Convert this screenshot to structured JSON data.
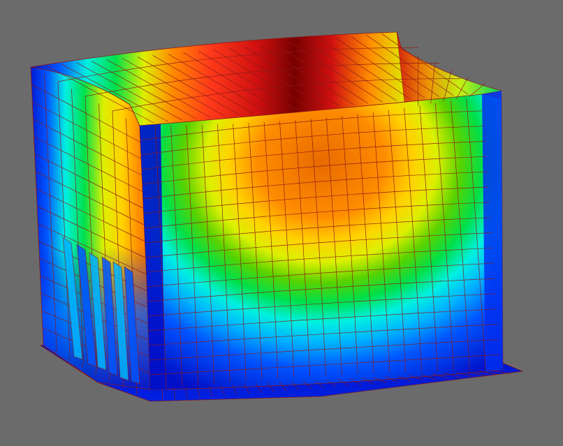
{
  "viewport": {
    "background": "#6b6b6b",
    "mesh_line_color": "#8b1a1a",
    "colormap": [
      "#0010c8",
      "#0055ff",
      "#00b4ff",
      "#00f0e0",
      "#00e04a",
      "#5ad200",
      "#dcf000",
      "#ffd200",
      "#ff8c00",
      "#e86a00",
      "#ff3a1a",
      "#d01010",
      "#780000"
    ]
  }
}
